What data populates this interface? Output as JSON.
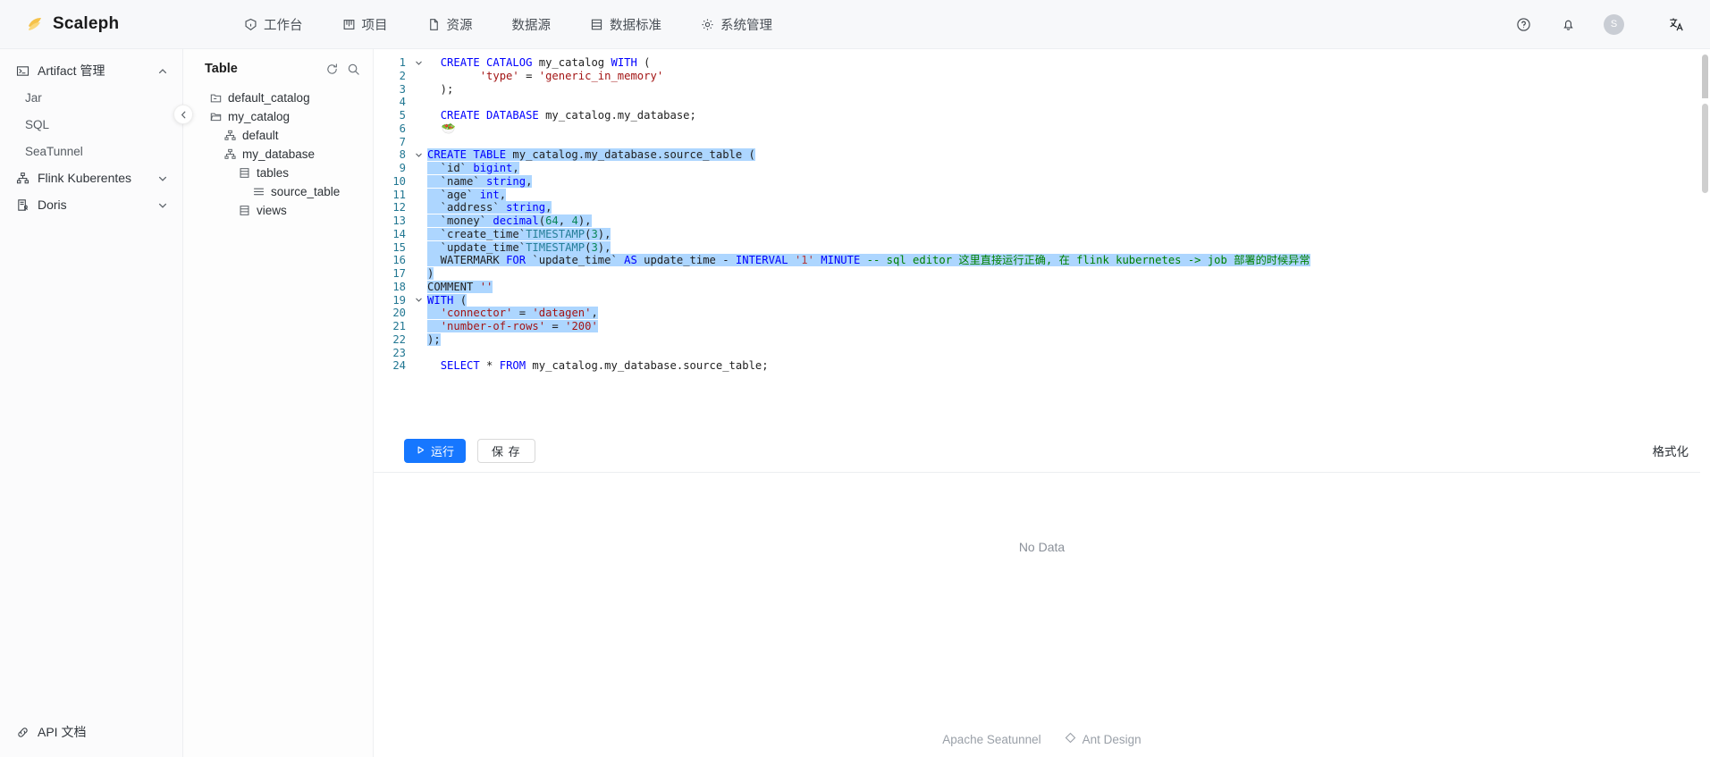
{
  "header": {
    "brand": "Scaleph",
    "nav": [
      {
        "label": "工作台",
        "icon": "dashboard-icon"
      },
      {
        "label": "项目",
        "icon": "project-icon"
      },
      {
        "label": "资源",
        "icon": "file-icon"
      },
      {
        "label": "数据源",
        "icon": "none"
      },
      {
        "label": "数据标准",
        "icon": "database-icon"
      },
      {
        "label": "系统管理",
        "icon": "gear-icon"
      }
    ],
    "actions": [
      {
        "name": "help-icon",
        "glyph": "?"
      },
      {
        "name": "bell-icon",
        "glyph": "bell"
      },
      {
        "name": "avatar",
        "glyph": "S"
      },
      {
        "name": "language-icon",
        "glyph": "文A"
      }
    ]
  },
  "sidebar": {
    "group_label": "Artifact 管理",
    "items": [
      {
        "label": "Jar"
      },
      {
        "label": "SQL"
      },
      {
        "label": "SeaTunnel"
      }
    ],
    "entries": [
      {
        "label": "Flink Kuberentes",
        "icon": "flink-icon",
        "expandable": true
      },
      {
        "label": "Doris",
        "icon": "doris-icon",
        "expandable": true
      }
    ],
    "bottom": {
      "label": "API 文档",
      "icon": "link-icon"
    }
  },
  "tree": {
    "title": "Table",
    "actions": [
      {
        "name": "refresh-icon"
      },
      {
        "name": "search-icon"
      }
    ],
    "nodes": [
      {
        "label": "default_catalog",
        "icon": "folder-closed-icon",
        "indent": 1
      },
      {
        "label": "my_catalog",
        "icon": "folder-open-icon",
        "indent": 1
      },
      {
        "label": "default",
        "icon": "schema-icon",
        "indent": 2
      },
      {
        "label": "my_database",
        "icon": "schema-icon",
        "indent": 2
      },
      {
        "label": "tables",
        "icon": "table-icon",
        "indent": 3
      },
      {
        "label": "source_table",
        "icon": "list-icon",
        "indent": 4
      },
      {
        "label": "views",
        "icon": "table-icon",
        "indent": 3
      }
    ]
  },
  "editor": {
    "first_line": 1,
    "total_lines": 24,
    "lines": [
      {
        "n": 1,
        "fold": "open",
        "tokens": [
          {
            "t": "  ",
            "c": "pl"
          },
          {
            "t": "CREATE CATALOG",
            "c": "kw"
          },
          {
            "t": " my_catalog ",
            "c": "pl"
          },
          {
            "t": "WITH",
            "c": "kw"
          },
          {
            "t": " (",
            "c": "pl"
          }
        ]
      },
      {
        "n": 2,
        "fold": "",
        "tokens": [
          {
            "t": "        ",
            "c": "pl"
          },
          {
            "t": "'type'",
            "c": "str"
          },
          {
            "t": " = ",
            "c": "pl"
          },
          {
            "t": "'generic_in_memory'",
            "c": "str"
          }
        ]
      },
      {
        "n": 3,
        "fold": "",
        "tokens": [
          {
            "t": "  );",
            "c": "pl"
          }
        ]
      },
      {
        "n": 4,
        "fold": "",
        "tokens": []
      },
      {
        "n": 5,
        "fold": "",
        "tokens": [
          {
            "t": "  ",
            "c": "pl"
          },
          {
            "t": "CREATE DATABASE",
            "c": "kw"
          },
          {
            "t": " my_catalog.my_database;",
            "c": "pl"
          }
        ]
      },
      {
        "n": 6,
        "fold": "",
        "tokens": [
          {
            "t": "  🥗",
            "c": "emoji"
          }
        ]
      },
      {
        "n": 7,
        "fold": "",
        "tokens": []
      },
      {
        "n": 8,
        "fold": "open",
        "sel": true,
        "cursor": true,
        "tokens": [
          {
            "t": "CREATE TABLE",
            "c": "kw"
          },
          {
            "t": " my_catalog.my_database.source_table (",
            "c": "pl"
          }
        ]
      },
      {
        "n": 9,
        "fold": "",
        "sel": true,
        "tokens": [
          {
            "t": "  `id` ",
            "c": "pl"
          },
          {
            "t": "bigint",
            "c": "kw"
          },
          {
            "t": ",",
            "c": "pl"
          }
        ]
      },
      {
        "n": 10,
        "fold": "",
        "sel": true,
        "tokens": [
          {
            "t": "  `name` ",
            "c": "pl"
          },
          {
            "t": "string",
            "c": "kw"
          },
          {
            "t": ",",
            "c": "pl"
          }
        ]
      },
      {
        "n": 11,
        "fold": "",
        "sel": true,
        "tokens": [
          {
            "t": "  `age` ",
            "c": "pl"
          },
          {
            "t": "int",
            "c": "kw"
          },
          {
            "t": ",",
            "c": "pl"
          }
        ]
      },
      {
        "n": 12,
        "fold": "",
        "sel": true,
        "tokens": [
          {
            "t": "  `address` ",
            "c": "pl"
          },
          {
            "t": "string",
            "c": "kw"
          },
          {
            "t": ",",
            "c": "pl"
          }
        ]
      },
      {
        "n": 13,
        "fold": "",
        "sel": true,
        "tokens": [
          {
            "t": "  `money` ",
            "c": "pl"
          },
          {
            "t": "decimal",
            "c": "kw"
          },
          {
            "t": "(",
            "c": "pl"
          },
          {
            "t": "64",
            "c": "num"
          },
          {
            "t": ", ",
            "c": "pl"
          },
          {
            "t": "4",
            "c": "num"
          },
          {
            "t": "),",
            "c": "pl"
          }
        ]
      },
      {
        "n": 14,
        "fold": "",
        "sel": true,
        "tokens": [
          {
            "t": "  `create_time`",
            "c": "pl"
          },
          {
            "t": "TIMESTAMP",
            "c": "type"
          },
          {
            "t": "(",
            "c": "pl"
          },
          {
            "t": "3",
            "c": "num"
          },
          {
            "t": "),",
            "c": "pl"
          }
        ]
      },
      {
        "n": 15,
        "fold": "",
        "sel": true,
        "tokens": [
          {
            "t": "  `update_time`",
            "c": "pl"
          },
          {
            "t": "TIMESTAMP",
            "c": "type"
          },
          {
            "t": "(",
            "c": "pl"
          },
          {
            "t": "3",
            "c": "num"
          },
          {
            "t": "),",
            "c": "pl"
          }
        ]
      },
      {
        "n": 16,
        "fold": "",
        "sel": true,
        "tokens": [
          {
            "t": "  WATERMARK ",
            "c": "pl"
          },
          {
            "t": "FOR",
            "c": "kw"
          },
          {
            "t": " `update_time` ",
            "c": "pl"
          },
          {
            "t": "AS",
            "c": "kw"
          },
          {
            "t": " update_time - ",
            "c": "pl"
          },
          {
            "t": "INTERVAL",
            "c": "kw"
          },
          {
            "t": " ",
            "c": "pl"
          },
          {
            "t": "'1'",
            "c": "strg"
          },
          {
            "t": " ",
            "c": "pl"
          },
          {
            "t": "MINUTE",
            "c": "kw"
          },
          {
            "t": " ",
            "c": "pl"
          },
          {
            "t": "-- sql editor 这里直接运行正确, 在 flink kubernetes -> job 部署的时候异常",
            "c": "cmt"
          }
        ]
      },
      {
        "n": 17,
        "fold": "",
        "sel": true,
        "tokens": [
          {
            "t": ")",
            "c": "pl"
          }
        ]
      },
      {
        "n": 18,
        "fold": "",
        "sel": true,
        "tokens": [
          {
            "t": "COMMENT ",
            "c": "pl"
          },
          {
            "t": "''",
            "c": "str"
          }
        ]
      },
      {
        "n": 19,
        "fold": "open",
        "sel": true,
        "tokens": [
          {
            "t": "WITH",
            "c": "kw"
          },
          {
            "t": " (",
            "c": "pl"
          }
        ]
      },
      {
        "n": 20,
        "fold": "",
        "sel": true,
        "tokens": [
          {
            "t": "  ",
            "c": "pl"
          },
          {
            "t": "'connector'",
            "c": "str"
          },
          {
            "t": " = ",
            "c": "pl"
          },
          {
            "t": "'datagen'",
            "c": "str"
          },
          {
            "t": ",",
            "c": "pl"
          }
        ]
      },
      {
        "n": 21,
        "fold": "",
        "sel": true,
        "tokens": [
          {
            "t": "  ",
            "c": "pl"
          },
          {
            "t": "'number-of-rows'",
            "c": "str"
          },
          {
            "t": " = ",
            "c": "pl"
          },
          {
            "t": "'200'",
            "c": "str"
          }
        ]
      },
      {
        "n": 22,
        "fold": "",
        "sel": true,
        "tokens": [
          {
            "t": ");",
            "c": "pl"
          }
        ]
      },
      {
        "n": 23,
        "fold": "",
        "tokens": []
      },
      {
        "n": 24,
        "fold": "",
        "tokens": [
          {
            "t": "  ",
            "c": "pl"
          },
          {
            "t": "SELECT",
            "c": "kw"
          },
          {
            "t": " * ",
            "c": "pl"
          },
          {
            "t": "FROM",
            "c": "kw"
          },
          {
            "t": " my_catalog.my_database.source_table;",
            "c": "pl"
          }
        ]
      }
    ]
  },
  "toolbar": {
    "run_label": "运行",
    "save_label": "保 存",
    "format_label": "格式化"
  },
  "result": {
    "empty_text": "No Data"
  },
  "footer": {
    "left_label": "Apache Seatunnel",
    "right_label": "Ant Design"
  },
  "colors": {
    "accent": "#1677ff",
    "selection": "#add6ff",
    "keyword": "#0000ff",
    "string": "#a31515",
    "comment": "#008000",
    "number": "#098658",
    "type": "#267f99",
    "line_number": "#237893"
  }
}
